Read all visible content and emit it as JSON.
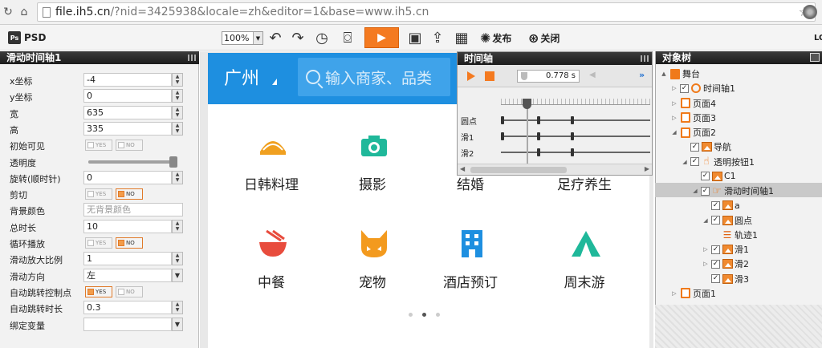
{
  "browser": {
    "url_host": "file.ih5.cn",
    "url_path": "/?nid=3425938&locale=zh&editor=1&base=www.ih5.cn"
  },
  "toolbar": {
    "psd_label": "PSD",
    "zoom": "100%",
    "publish_label": "发布",
    "close_label": "关闭",
    "right_edge_text": "LO"
  },
  "left_panel": {
    "title": "滑动时间轴1",
    "rows": [
      {
        "label": "x坐标",
        "value": "-4"
      },
      {
        "label": "y坐标",
        "value": "0"
      },
      {
        "label": "宽",
        "value": "635"
      },
      {
        "label": "高",
        "value": "335"
      },
      {
        "label": "初始可见",
        "yes": "YES",
        "no": "NO"
      },
      {
        "label": "透明度",
        "level": 0.96
      },
      {
        "label": "旋转(顺时针)",
        "value": "0"
      },
      {
        "label": "剪切",
        "yes": "YES",
        "no": "NO"
      },
      {
        "label": "背景颜色",
        "placeholder": "无背景颜色"
      },
      {
        "label": "总时长",
        "value": "10"
      },
      {
        "label": "循环播放",
        "yes": "YES",
        "no": "NO"
      },
      {
        "label": "滑动放大比例",
        "value": "1"
      },
      {
        "label": "滑动方向",
        "value": "左"
      },
      {
        "label": "自动跳转控制点",
        "yes": "YES",
        "no": "NO"
      },
      {
        "label": "自动跳转时长",
        "value": "0.3"
      },
      {
        "label": "绑定变量",
        "value": ""
      }
    ]
  },
  "phone": {
    "city": "广州",
    "search_placeholder": "输入商家、品类",
    "categories": [
      {
        "name": "日韩料理",
        "icon": "sushi-icon",
        "color": "#f0a020"
      },
      {
        "name": "摄影",
        "icon": "camera-icon",
        "color": "#1fb89a"
      },
      {
        "name": "结婚",
        "icon": "ring-icon",
        "color": "#e85060"
      },
      {
        "name": "足疗养生",
        "icon": "foot-icon",
        "color": "#3aa0e0"
      },
      {
        "name": "中餐",
        "icon": "bowl-icon",
        "color": "#e84c3d"
      },
      {
        "name": "宠物",
        "icon": "cat-icon",
        "color": "#f39a1e"
      },
      {
        "name": "酒店预订",
        "icon": "hotel-icon",
        "color": "#1e8fe0"
      },
      {
        "name": "周末游",
        "icon": "tent-icon",
        "color": "#1fb89a"
      }
    ]
  },
  "timeline": {
    "title": "时间轴",
    "time": "0.778 s",
    "tracks": [
      {
        "name": "圆点",
        "keyframes": [
          0.0,
          0.24,
          0.47
        ]
      },
      {
        "name": "滑1",
        "keyframes": [
          0.0,
          0.24,
          0.47
        ]
      },
      {
        "name": "滑2",
        "keyframes": [
          0.24,
          0.47
        ]
      }
    ],
    "playhead": 0.17
  },
  "object_tree": {
    "title": "对象树",
    "nodes": [
      {
        "label": "舞台",
        "depth": 0,
        "twisty": "▲",
        "icon": "stage-icon",
        "checked": null
      },
      {
        "label": "时间轴1",
        "depth": 1,
        "twisty": "▷",
        "icon": "clock-icon",
        "checked": true
      },
      {
        "label": "页面4",
        "depth": 1,
        "twisty": "▷",
        "icon": "page-icon",
        "checked": null
      },
      {
        "label": "页面3",
        "depth": 1,
        "twisty": "▷",
        "icon": "page-icon",
        "checked": null
      },
      {
        "label": "页面2",
        "depth": 1,
        "twisty": "◢",
        "icon": "page-icon",
        "checked": null
      },
      {
        "label": "导航",
        "depth": 2,
        "twisty": "",
        "icon": "image-icon",
        "checked": true
      },
      {
        "label": "透明按钮1",
        "depth": 2,
        "twisty": "◢",
        "icon": "hand-icon",
        "checked": true
      },
      {
        "label": "C1",
        "depth": 3,
        "twisty": "",
        "icon": "image-icon",
        "checked": true
      },
      {
        "label": "滑动时间轴1",
        "depth": 3,
        "twisty": "◢",
        "icon": "swipe-icon",
        "checked": true,
        "selected": true
      },
      {
        "label": "a",
        "depth": 4,
        "twisty": "",
        "icon": "image-icon",
        "checked": true
      },
      {
        "label": "圆点",
        "depth": 4,
        "twisty": "◢",
        "icon": "image-icon",
        "checked": true
      },
      {
        "label": "轨迹1",
        "depth": 5,
        "twisty": "",
        "icon": "track-icon",
        "checked": null
      },
      {
        "label": "滑1",
        "depth": 4,
        "twisty": "▷",
        "icon": "image-icon",
        "checked": true
      },
      {
        "label": "滑2",
        "depth": 4,
        "twisty": "▷",
        "icon": "image-icon",
        "checked": true
      },
      {
        "label": "滑3",
        "depth": 4,
        "twisty": "",
        "icon": "image-icon",
        "checked": true
      },
      {
        "label": "页面1",
        "depth": 1,
        "twisty": "▷",
        "icon": "page-icon",
        "checked": null
      }
    ]
  },
  "colors": {
    "accent": "#f47a20",
    "phone_header": "#1e8fe0"
  }
}
